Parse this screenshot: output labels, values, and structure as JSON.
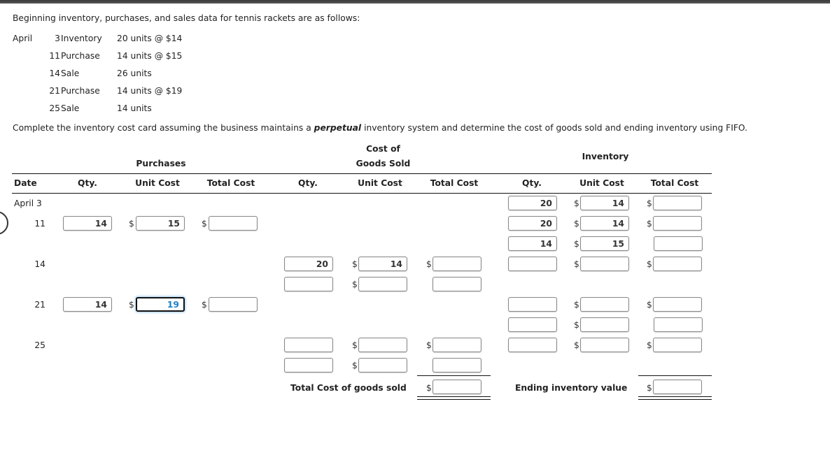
{
  "intro": "Beginning inventory, purchases, and sales data for tennis rackets are as follows:",
  "given": {
    "month": "April",
    "rows": [
      {
        "day": "3",
        "type": "Inventory",
        "detail": "20 units @  $14"
      },
      {
        "day": "11",
        "type": "Purchase",
        "detail": "14 units @  $15"
      },
      {
        "day": "14",
        "type": "Sale",
        "detail": "26 units"
      },
      {
        "day": "21",
        "type": "Purchase",
        "detail": "14 units @  $19"
      },
      {
        "day": "25",
        "type": "Sale",
        "detail": "14 units"
      }
    ]
  },
  "instructions": {
    "before": "Complete the inventory cost card assuming the business maintains a ",
    "emph": "perpetual",
    "after": " inventory system and determine the cost of goods sold and ending inventory using FIFO."
  },
  "headers": {
    "purchases": "Purchases",
    "cogs_line1": "Cost of",
    "cogs_line2": "Goods Sold",
    "inventory": "Inventory",
    "date": "Date",
    "qty": "Qty.",
    "unit_cost": "Unit Cost",
    "total_cost": "Total Cost"
  },
  "currency_symbol": "$",
  "dates": {
    "apr3": "April  3",
    "d11": "11",
    "d14": "14",
    "d21": "21",
    "d25": "25"
  },
  "inputs": {
    "p11_qty": "14",
    "p11_unit": "15",
    "p11_total": "",
    "p21_qty": "14",
    "p21_unit": "19",
    "p21_total": "",
    "c14a_qty": "20",
    "c14a_unit": "14",
    "c14a_total": "",
    "c14b_qty": "",
    "c14b_unit": "",
    "c14b_total": "",
    "c25a_qty": "",
    "c25a_unit": "",
    "c25a_total": "",
    "c25b_qty": "",
    "c25b_unit": "",
    "c25b_total": "",
    "cogs_total": "",
    "i3_qty": "20",
    "i3_unit": "14",
    "i3_total": "",
    "i11a_qty": "20",
    "i11a_unit": "14",
    "i11a_total": "",
    "i11b_qty": "14",
    "i11b_unit": "15",
    "i11b_total": "",
    "i14_qty": "",
    "i14_unit": "",
    "i14_total": "",
    "i21a_qty": "",
    "i21a_unit": "",
    "i21a_total": "",
    "i21b_qty": "",
    "i21b_unit": "",
    "i21b_total": "",
    "i25_qty": "",
    "i25_unit": "",
    "i25_total": "",
    "ending_total": ""
  },
  "labels": {
    "total_cogs": "Total Cost of goods sold",
    "ending_inventory": "Ending inventory value"
  }
}
